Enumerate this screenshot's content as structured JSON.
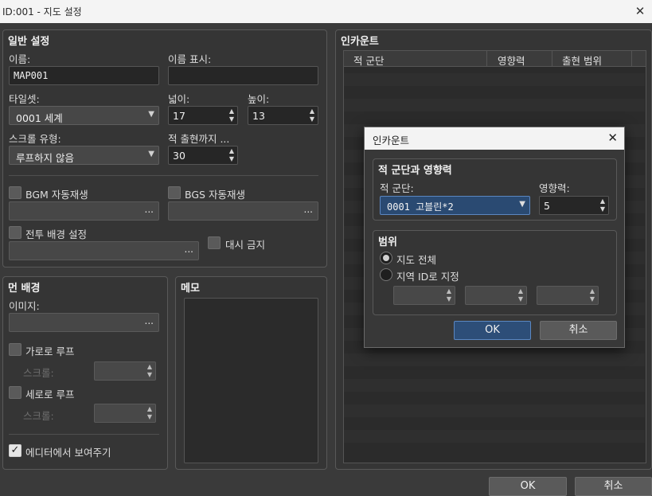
{
  "window": {
    "title": "ID:001 - 지도 설정",
    "close_icon": "close-icon"
  },
  "general": {
    "title": "일반 설정",
    "name_label": "이름:",
    "name_value": "MAP001",
    "display_label": "이름 표시:",
    "display_value": "",
    "tileset_label": "타일셋:",
    "tileset_value": "0001 세계",
    "width_label": "넓이:",
    "width_value": "17",
    "height_label": "높이:",
    "height_value": "13",
    "scroll_label": "스크롤 유형:",
    "scroll_value": "루프하지 않음",
    "steps_label": "적 출현까지 ...",
    "steps_value": "30",
    "bgm_label": "BGM 자동재생",
    "bgs_label": "BGS 자동재생",
    "battleback_label": "전투 배경 설정",
    "nodash_label": "대시 금지",
    "dots": "..."
  },
  "parallax": {
    "title": "먼 배경",
    "image_label": "이미지:",
    "loop_h_label": "가로로 루프",
    "loop_v_label": "세로로 루프",
    "scroll_label": "스크롤:",
    "show_editor_label": "에디터에서 보여주기",
    "dots": "..."
  },
  "memo": {
    "title": "메모"
  },
  "encounters": {
    "title": "인카운트",
    "columns": [
      "적 군단",
      "영향력",
      "출현 범위"
    ]
  },
  "modal": {
    "title": "인카운트",
    "group_title": "적 군단과 영향력",
    "troop_label": "적 군단:",
    "troop_value": "0001 고블린*2",
    "weight_label": "영향력:",
    "weight_value": "5",
    "range_title": "범위",
    "whole_map": "지도 전체",
    "region_label": "지역 ID로 지정",
    "ok": "OK",
    "cancel": "취소"
  },
  "footer": {
    "ok": "OK",
    "cancel": "취소"
  }
}
